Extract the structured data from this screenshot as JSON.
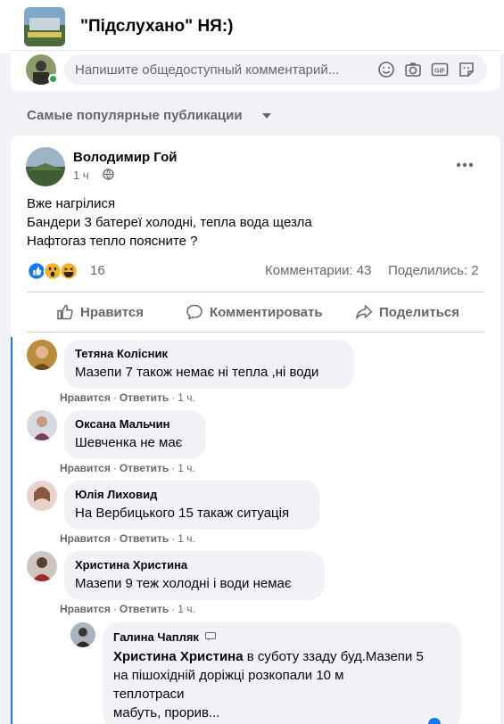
{
  "header": {
    "group_title": "\"Підслухано\" НЯ:)"
  },
  "composer": {
    "placeholder": "Напишите общедоступный комментарий...",
    "icons": [
      "emoji-icon",
      "camera-icon",
      "gif-icon",
      "sticker-icon"
    ]
  },
  "feed": {
    "section_heading": "Самые популярные публикации"
  },
  "post": {
    "author": "Володимир Гой",
    "time": "1 ч",
    "lines": [
      "Вже нагрілися",
      "Бандери 3 батереї холодні, тепла вода щезла",
      "Нафтогаз тепло  поясните ?"
    ],
    "reaction_count": "16",
    "reaction_types": [
      "like",
      "wow",
      "haha"
    ],
    "comments_label": "Комментарии: 43",
    "shares_label": "Поделились: 2",
    "actions": {
      "like": "Нравится",
      "comment": "Комментировать",
      "share": "Поделиться"
    }
  },
  "comments": [
    {
      "name": "Тетяна Колісник",
      "text": "Мазепи 7 також немає ні тепла ,ні води",
      "like": "Нравится",
      "reply": "Ответить",
      "time": "1 ч."
    },
    {
      "name": "Оксана Мальчин",
      "text": "Шевченка не має",
      "like": "Нравится",
      "reply": "Ответить",
      "time": "1 ч."
    },
    {
      "name": "Юлія Лиховид",
      "text": "На Вербицького 15 такаж ситуація",
      "like": "Нравится",
      "reply": "Ответить",
      "time": "1 ч."
    },
    {
      "name": "Христина Христина",
      "text": "Мазепи 9 теж холодні і води немає",
      "like": "Нравится",
      "reply": "Ответить",
      "time": "1 ч."
    }
  ],
  "reply": {
    "name": "Галина Чапляк",
    "mention": "Христина Христина",
    "text_line1": " в суботу ззаду буд.Мазепи 5",
    "text_line2": "на пішохідній доріжці розкопали 10 м",
    "text_line3": "теплотраси",
    "text_line4": "мабуть, прорив..."
  },
  "colors": {
    "accent": "#1877f2",
    "secondary_text": "#65676b",
    "bubble": "#f0f2f5",
    "online": "#31a24c"
  }
}
